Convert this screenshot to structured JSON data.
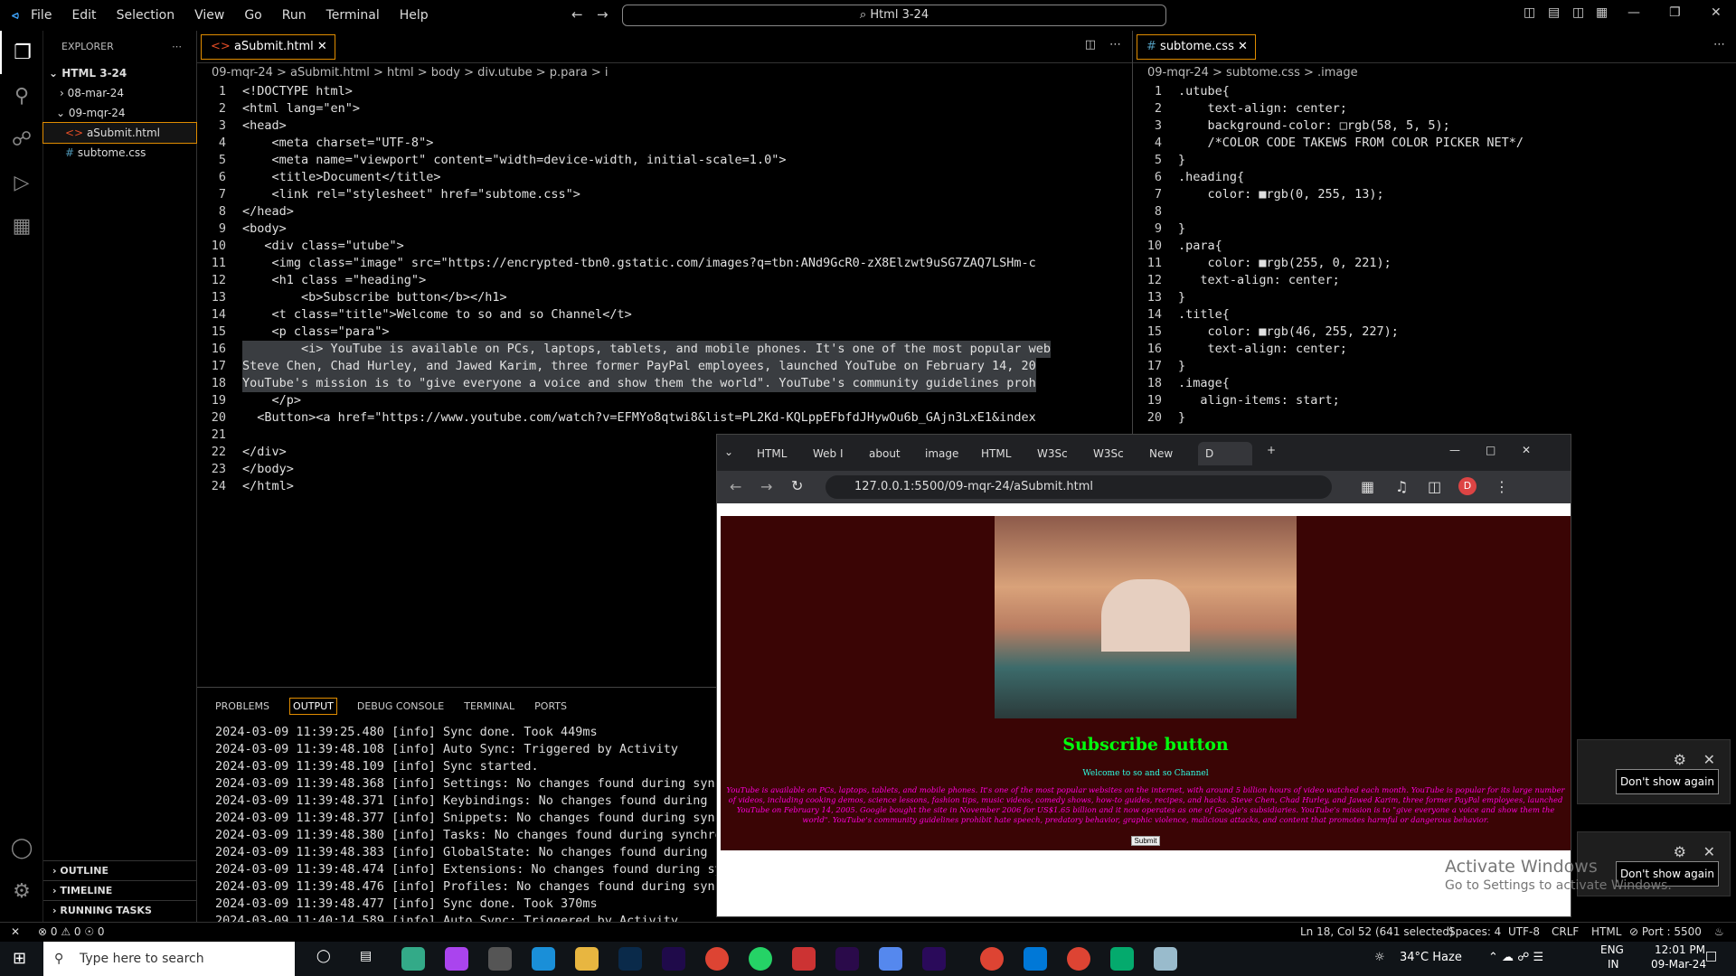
{
  "titlebar": {
    "menus": [
      "File",
      "Edit",
      "Selection",
      "View",
      "Go",
      "Run",
      "Terminal",
      "Help"
    ],
    "command_center": "Html 3-24"
  },
  "explorer": {
    "header": "EXPLORER",
    "root": "HTML 3-24",
    "items": [
      "08-mar-24",
      "09-mqr-24",
      "aSubmit.html",
      "subtome.css"
    ],
    "sections": [
      "OUTLINE",
      "TIMELINE",
      "RUNNING TASKS"
    ]
  },
  "editor_left": {
    "tab": "aSubmit.html",
    "breadcrumb": "09-mqr-24 > aSubmit.html > html > body > div.utube > p.para > i",
    "lines": [
      "<!DOCTYPE html>",
      "<html lang=\"en\">",
      "<head>",
      "    <meta charset=\"UTF-8\">",
      "    <meta name=\"viewport\" content=\"width=device-width, initial-scale=1.0\">",
      "    <title>Document</title>",
      "    <link rel=\"stylesheet\" href=\"subtome.css\">",
      "</head>",
      "<body>",
      "   <div class=\"utube\">",
      "    <img class=\"image\" src=\"https://encrypted-tbn0.gstatic.com/images?q=tbn:ANd9GcR0-zX8Elzwt9uSG7ZAQ7LSHm-c",
      "    <h1 class =\"heading\">",
      "        <b>Subscribe button</b></h1>",
      "    <t class=\"title\">Welcome to so and so Channel</t>",
      "    <p class=\"para\">",
      "        <i> YouTube is available on PCs, laptops, tablets, and mobile phones. It's one of the most popular web",
      "Steve Chen, Chad Hurley, and Jawed Karim, three former PayPal employees, launched YouTube on February 14, 20",
      "YouTube's mission is to \"give everyone a voice and show them the world\". YouTube's community guidelines proh",
      "    </p>",
      "  <Button><a href=\"https://www.youtube.com/watch?v=EFMYo8qtwi8&list=PL2Kd-KQLppEFbfdJHywOu6b_GAjn3LxE1&index",
      "",
      "</div>",
      "</body>",
      "</html>"
    ]
  },
  "editor_right": {
    "tab": "subtome.css",
    "breadcrumb": "09-mqr-24 > subtome.css > .image",
    "lines": [
      ".utube{",
      "    text-align: center;",
      "    background-color: □rgb(58, 5, 5);",
      "    /*COLOR CODE TAKEWS FROM COLOR PICKER NET*/",
      "}",
      ".heading{",
      "    color: ■rgb(0, 255, 13);",
      "",
      "}",
      ".para{",
      "    color: ■rgb(255, 0, 221);",
      "   text-align: center;",
      "}",
      ".title{",
      "    color: ■rgb(46, 255, 227);",
      "    text-align: center;",
      "}",
      ".image{",
      "   align-items: start;",
      "}"
    ]
  },
  "panel": {
    "tabs": [
      "PROBLEMS",
      "OUTPUT",
      "DEBUG CONSOLE",
      "TERMINAL",
      "PORTS"
    ],
    "log": [
      "2024-03-09 11:39:25.480 [info] Sync done. Took 449ms",
      "2024-03-09 11:39:48.108 [info] Auto Sync: Triggered by Activity",
      "2024-03-09 11:39:48.109 [info] Sync started.",
      "2024-03-09 11:39:48.368 [info] Settings: No changes found during synchro",
      "2024-03-09 11:39:48.371 [info] Keybindings: No changes found during sync",
      "2024-03-09 11:39:48.377 [info] Snippets: No changes found during synchro",
      "2024-03-09 11:39:48.380 [info] Tasks: No changes found during synchroniz",
      "2024-03-09 11:39:48.383 [info] GlobalState: No changes found during sync",
      "2024-03-09 11:39:48.474 [info] Extensions: No changes found during synch",
      "2024-03-09 11:39:48.476 [info] Profiles: No changes found during synchro",
      "2024-03-09 11:39:48.477 [info] Sync done. Took 370ms",
      "2024-03-09 11:40:14.589 [info] Auto Sync: Triggered by Activity"
    ]
  },
  "browser": {
    "tabs": [
      "HTML",
      "Web I",
      "about",
      "image",
      "HTML",
      "W3Sc",
      "W3Sc",
      "New",
      "D"
    ],
    "url": "127.0.0.1:5500/09-mqr-24/aSubmit.html",
    "page": {
      "heading": "Subscribe button",
      "title": "Welcome to so and so Channel",
      "para": "YouTube is available on PCs, laptops, tablets, and mobile phones. It's one of the most popular websites on the internet, with around 5 billion hours of video watched each month. YouTube is popular for its large number of videos, including cooking demos, science lessons, fashion tips, music videos, comedy shows, how-to guides, recipes, and hacks. Steve Chen, Chad Hurley, and Jawed Karim, three former PayPal employees, launched YouTube on February 14, 2005. Google bought the site in November 2006 for US$1.65 billion and it now operates as one of Google's subsidiaries. YouTube's mission is to \"give everyone a voice and show them the world\". YouTube's community guidelines prohibit hate speech, predatory behavior, graphic violence, malicious attacks, and content that promotes harmful or dangerous behavior.",
      "button": "Submit"
    }
  },
  "notifications": {
    "button": "Don't show again"
  },
  "watermark": {
    "line1": "Activate Windows",
    "line2": "Go to Settings to activate Windows."
  },
  "statusbar": {
    "left": "⊗ 0 ⚠ 0   ☉ 0",
    "position": "Ln 18, Col 52 (641 selected)",
    "spaces": "Spaces: 4",
    "encoding": "UTF-8",
    "eol": "CRLF",
    "lang": "HTML",
    "port": "⊘ Port : 5500"
  },
  "taskbar": {
    "search": "Type here to search",
    "weather": "34°C  Haze",
    "lang": "ENG",
    "lang2": "IN",
    "time": "12:01 PM",
    "date": "09-Mar-24"
  }
}
